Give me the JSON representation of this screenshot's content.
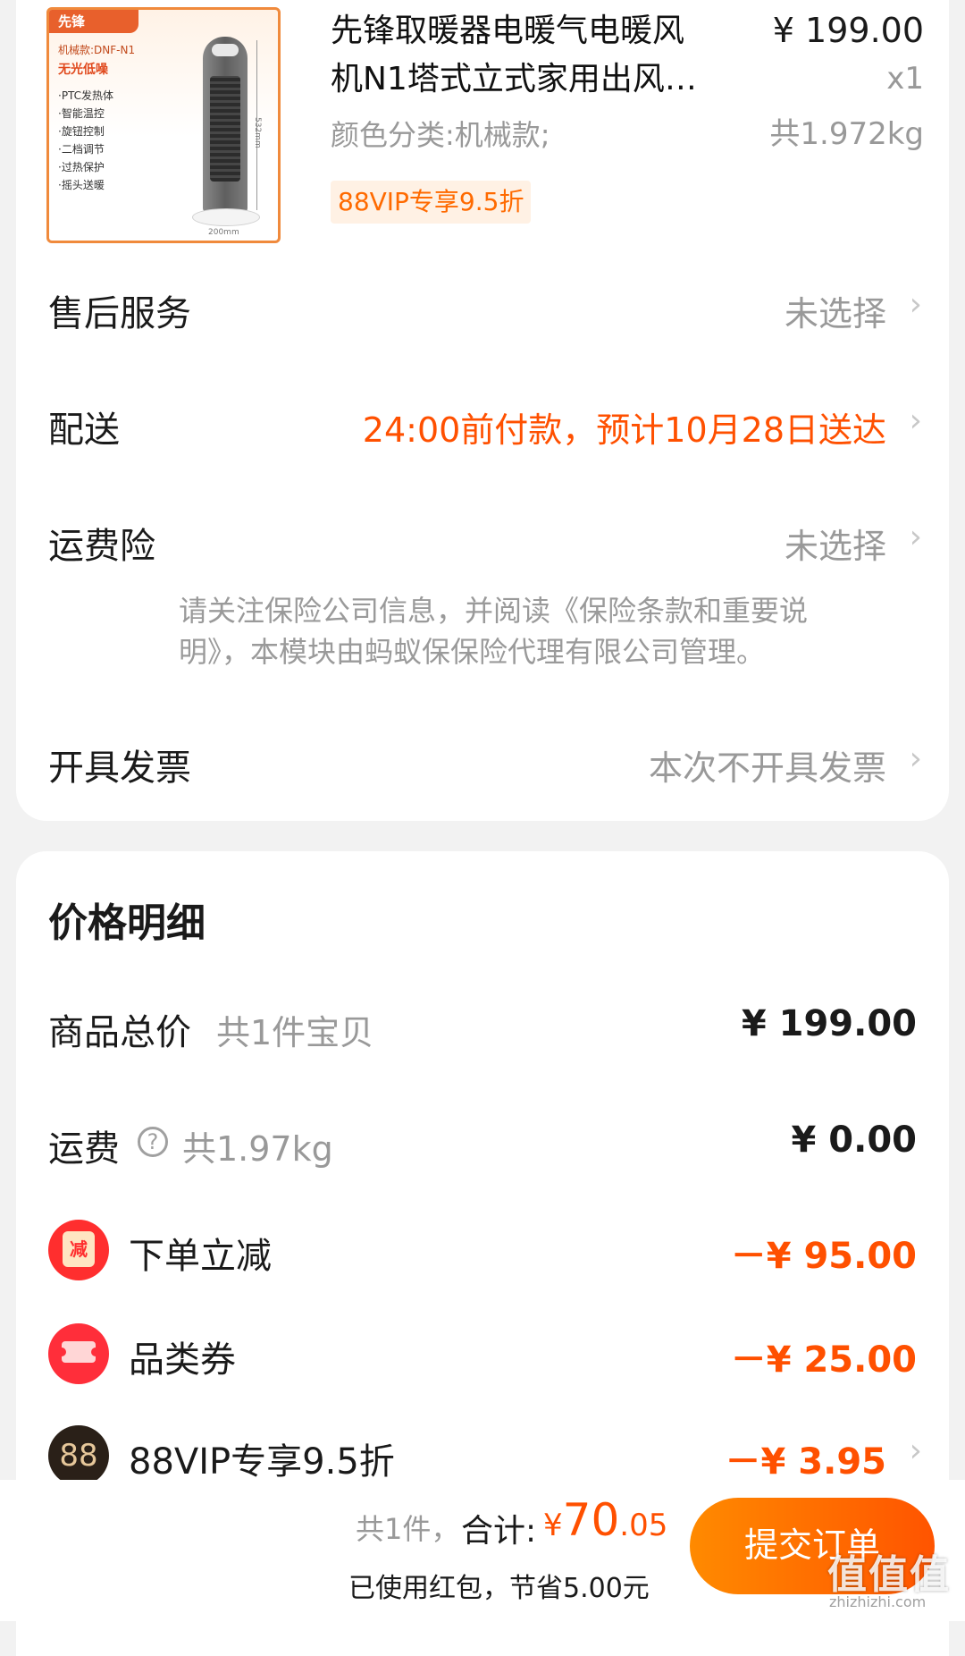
{
  "product": {
    "title_line1": "先锋取暖器电暖气电暖风",
    "title_line2": "机N1塔式立式家用出风…",
    "price": "¥ 199.00",
    "quantity": "x1",
    "weight": "共1.972kg",
    "variant": "颜色分类:机械款;",
    "promo_tag": "88VIP专享9.5折",
    "thumbnail": {
      "brand": "先锋",
      "model": "机械款:DNF-N1",
      "tagline": "无光低噪",
      "features": [
        "·PTC发热体",
        "·智能温控",
        "·旋钮控制",
        "·二档调节",
        "·过热保护",
        "·摇头送暖"
      ],
      "width_label": "200mm",
      "height_label": "532mm"
    }
  },
  "options": {
    "after_sales": {
      "label": "售后服务",
      "value": "未选择"
    },
    "delivery": {
      "label": "配送",
      "value": "24:00前付款，预计10月28日送达"
    },
    "shipping_insurance": {
      "label": "运费险",
      "value": "未选择",
      "note": "请关注保险公司信息，并阅读《保险条款和重要说明》，本模块由蚂蚁保保险代理有限公司管理。"
    },
    "invoice": {
      "label": "开具发票",
      "value": "本次不开具发票"
    }
  },
  "price_detail": {
    "title": "价格明细",
    "goods_total": {
      "label": "商品总价",
      "sub": "共1件宝贝",
      "amount": "¥ 199.00"
    },
    "shipping": {
      "label": "运费",
      "help": "?",
      "sub": "共1.97kg",
      "amount": "¥ 0.00"
    },
    "discounts": [
      {
        "icon": "减",
        "label": "下单立减",
        "amount": "－¥ 95.00"
      },
      {
        "icon": "ticket",
        "label": "品类券",
        "amount": "－¥ 25.00"
      },
      {
        "icon": "88",
        "label": "88VIP专享9.5折",
        "amount": "－¥ 3.95"
      }
    ]
  },
  "bottom_bar": {
    "count": "共1件，",
    "total_label": "合计:",
    "total_currency": "¥",
    "total_int": "70",
    "total_dec": ".05",
    "saved": "已使用红包，节省5.00元",
    "submit": "提交订单"
  },
  "watermark": {
    "text": "值值值",
    "sub": "zhizhizhi.com"
  },
  "colors": {
    "accent": "#ff5000",
    "button_start": "#ff8a00",
    "button_end": "#ff5400",
    "muted": "#999999"
  }
}
